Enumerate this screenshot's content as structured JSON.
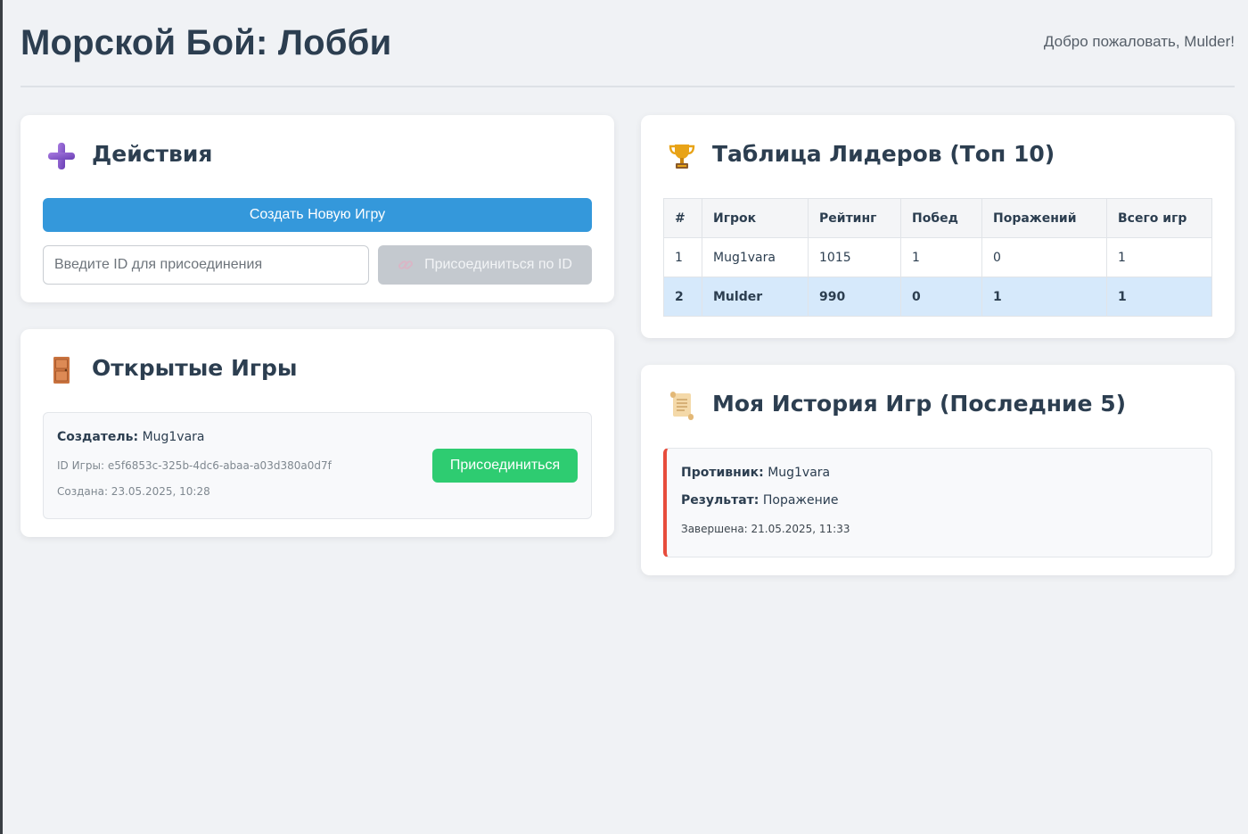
{
  "header": {
    "title": "Морской Бой: Лобби",
    "welcome": "Добро пожаловать, Mulder!"
  },
  "actions": {
    "title": "Действия",
    "icon": "plus-icon",
    "create_button": "Создать Новую Игру",
    "join_input_placeholder": "Введите ID для присоединения",
    "join_by_id_button": "Присоединиться по ID",
    "join_by_id_icon": "link-icon"
  },
  "open_games": {
    "title": "Открытые Игры",
    "icon": "door-icon",
    "items": [
      {
        "creator_label": "Создатель:",
        "creator": "Mug1vara",
        "id_text": "ID Игры: e5f6853c-325b-4dc6-abaa-a03d380a0d7f",
        "created_text": "Создана: 23.05.2025, 10:28",
        "join_button": "Присоединиться"
      }
    ]
  },
  "leaderboard": {
    "title": "Таблица Лидеров (Топ 10)",
    "icon": "trophy-icon",
    "columns": [
      "#",
      "Игрок",
      "Рейтинг",
      "Побед",
      "Поражений",
      "Всего игр"
    ],
    "rows": [
      [
        "1",
        "Mug1vara",
        "1015",
        "1",
        "0",
        "1"
      ],
      [
        "2",
        "Mulder",
        "990",
        "0",
        "1",
        "1"
      ]
    ],
    "highlight_color": "#d6e9fb"
  },
  "history": {
    "title": "Моя История Игр (Последние 5)",
    "icon": "scroll-icon",
    "items": [
      {
        "opponent_label": "Противник:",
        "opponent": "Mug1vara",
        "result_label": "Результат:",
        "result": "Поражение",
        "finished_text": "Завершена: 21.05.2025, 11:33"
      }
    ]
  },
  "colors": {
    "primary": "#3498db",
    "success": "#2ecc71",
    "loss": "#e74c3c",
    "disabled": "#c4c9cf"
  }
}
